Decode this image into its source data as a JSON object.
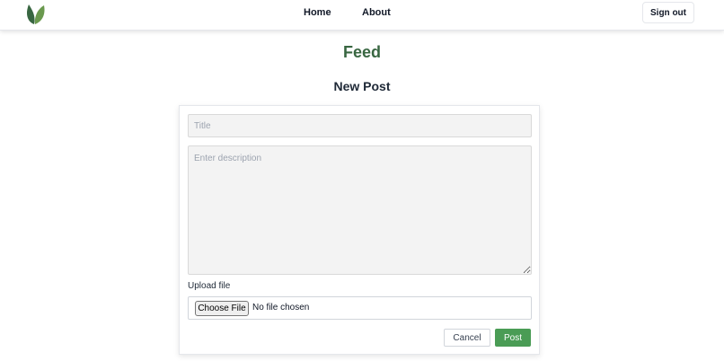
{
  "nav": {
    "links": [
      {
        "label": "Home"
      },
      {
        "label": "About"
      }
    ],
    "sign_out_label": "Sign out",
    "logo_icon": "leaf-icon"
  },
  "page": {
    "title": "Feed",
    "subtitle": "New Post"
  },
  "form": {
    "title_placeholder": "Title",
    "title_value": "",
    "description_placeholder": "Enter description",
    "description_value": "",
    "upload_label": "Upload file",
    "choose_file_label": "Choose File",
    "file_status": "No file chosen",
    "cancel_label": "Cancel",
    "post_label": "Post"
  },
  "colors": {
    "brand_green": "#386641",
    "button_green": "#4a9c55",
    "leaf_dark": "#386641",
    "leaf_light": "#6a994e"
  }
}
